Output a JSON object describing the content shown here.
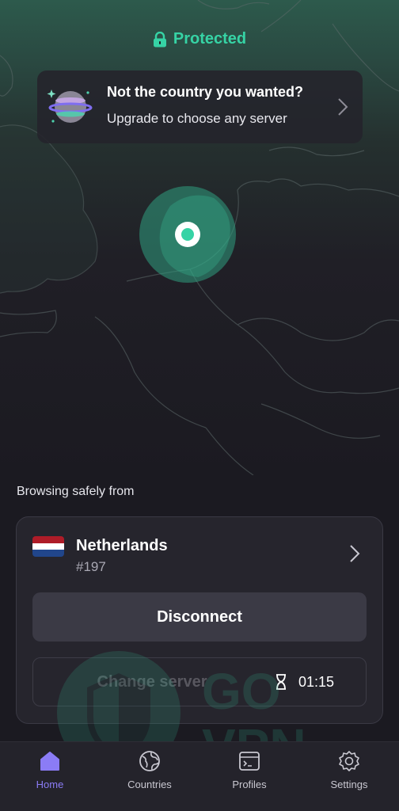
{
  "status": {
    "text": "Protected",
    "icon": "lock-icon",
    "color": "#36d3a5"
  },
  "promo": {
    "title": "Not the country you wanted?",
    "subtitle": "Upgrade to choose any server",
    "icon": "globe-icon"
  },
  "connection": {
    "heading": "Browsing safely from",
    "country": "Netherlands",
    "server": "#197",
    "flag": [
      "#ae1c28",
      "#ffffff",
      "#21468b"
    ],
    "disconnect_label": "Disconnect",
    "change_server_label": "Change server",
    "timer": "01:15"
  },
  "tabs": [
    {
      "label": "Home",
      "icon": "home-icon",
      "active": true
    },
    {
      "label": "Countries",
      "icon": "globe-icon",
      "active": false
    },
    {
      "label": "Profiles",
      "icon": "terminal-icon",
      "active": false
    },
    {
      "label": "Settings",
      "icon": "gear-icon",
      "active": false
    }
  ],
  "colors": {
    "accent": "#8b7cf6",
    "connected": "#36d3a5",
    "background": "#1b1a21"
  }
}
